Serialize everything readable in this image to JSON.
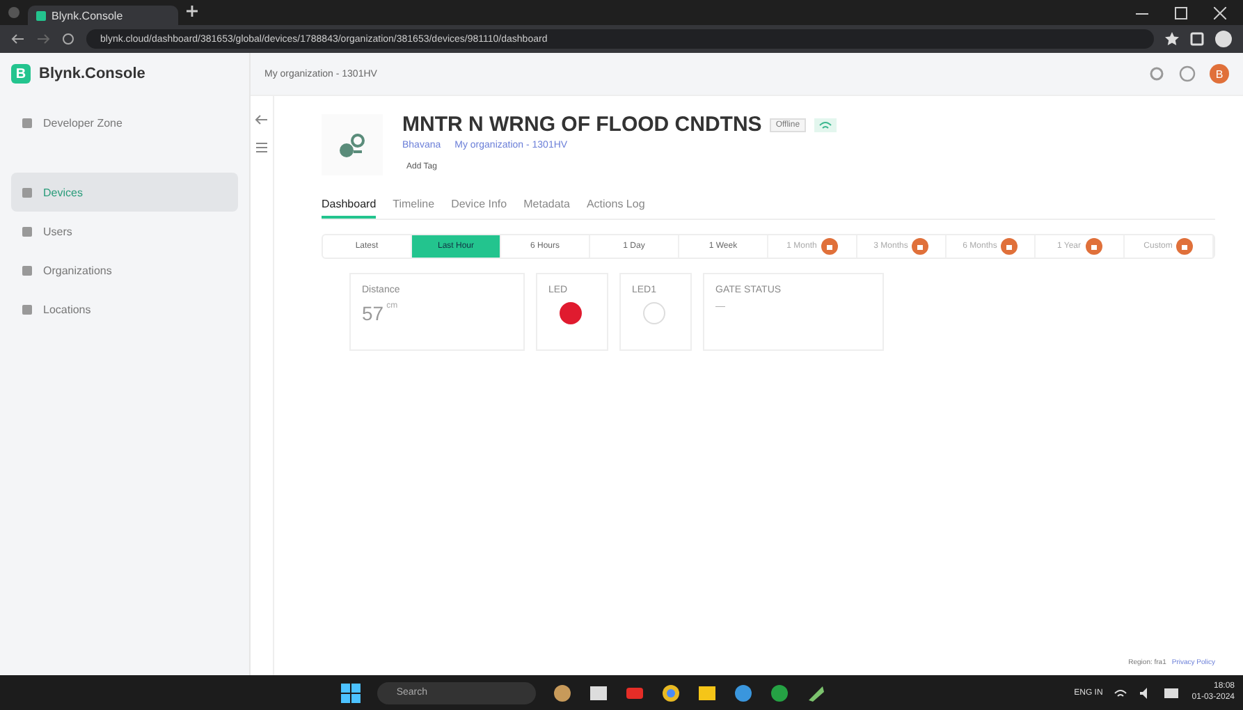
{
  "browser": {
    "tab_title": "Blynk.Console",
    "url": "blynk.cloud/dashboard/381653/global/devices/1788843/organization/381653/devices/981110/dashboard"
  },
  "app": {
    "logo_letter": "B",
    "logo_text": "Blynk.Console",
    "org_selector": "My organization - 1301HV",
    "user_initial": "B"
  },
  "sidebar": {
    "top_items": [
      {
        "label": "Developer Zone",
        "selected": false
      }
    ],
    "items": [
      {
        "label": "Devices",
        "selected": true
      },
      {
        "label": "Users",
        "selected": false
      },
      {
        "label": "Organizations",
        "selected": false
      },
      {
        "label": "Locations",
        "selected": false
      }
    ]
  },
  "device": {
    "name": "MNTR N WRNG OF FLOOD CNDTNS",
    "status": "Offline",
    "owner": "Bhavana",
    "organization": "My organization - 1301HV",
    "add_tag": "Add Tag"
  },
  "tabs": [
    {
      "label": "Dashboard",
      "selected": true
    },
    {
      "label": "Timeline",
      "selected": false
    },
    {
      "label": "Device Info",
      "selected": false
    },
    {
      "label": "Metadata",
      "selected": false
    },
    {
      "label": "Actions Log",
      "selected": false
    }
  ],
  "time_ranges": [
    {
      "label": "Latest",
      "selected": false,
      "locked": false
    },
    {
      "label": "Last Hour",
      "selected": true,
      "locked": false
    },
    {
      "label": "6 Hours",
      "selected": false,
      "locked": false
    },
    {
      "label": "1 Day",
      "selected": false,
      "locked": false
    },
    {
      "label": "1 Week",
      "selected": false,
      "locked": false
    },
    {
      "label": "1 Month",
      "selected": false,
      "locked": true
    },
    {
      "label": "3 Months",
      "selected": false,
      "locked": true
    },
    {
      "label": "6 Months",
      "selected": false,
      "locked": true
    },
    {
      "label": "1 Year",
      "selected": false,
      "locked": true
    },
    {
      "label": "Custom",
      "selected": false,
      "locked": true
    }
  ],
  "widgets": [
    {
      "kind": "value",
      "title": "Distance",
      "value": "57",
      "unit": "cm"
    },
    {
      "kind": "led",
      "title": "LED",
      "on": true
    },
    {
      "kind": "led",
      "title": "LED1",
      "on": false
    },
    {
      "kind": "label",
      "title": "GATE STATUS",
      "value": "—"
    }
  ],
  "footer": {
    "region": "Region: fra1",
    "privacy": "Privacy Policy"
  },
  "taskbar": {
    "search": "Search",
    "language": "ENG IN",
    "time": "18:08",
    "date": "01-03-2024"
  }
}
